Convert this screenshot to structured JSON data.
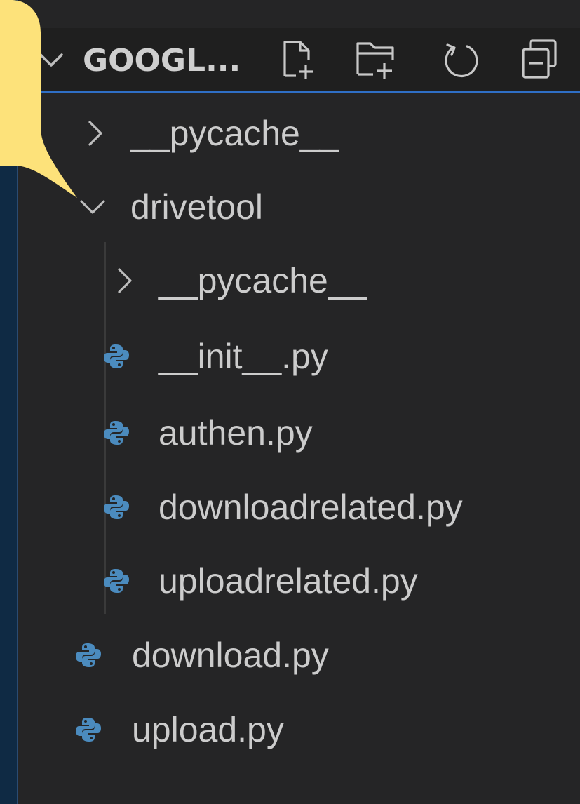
{
  "explorer": {
    "title": "GOOGL...",
    "actions": [
      {
        "name": "new-file-button",
        "icon": "new-file-icon"
      },
      {
        "name": "new-folder-button",
        "icon": "new-folder-icon"
      },
      {
        "name": "refresh-button",
        "icon": "refresh-icon"
      },
      {
        "name": "collapse-all-button",
        "icon": "collapse-all-icon"
      }
    ],
    "tree": [
      {
        "label": "__pycache__",
        "kind": "folder",
        "expanded": false,
        "depth": 0
      },
      {
        "label": "drivetool",
        "kind": "folder",
        "expanded": true,
        "depth": 0
      },
      {
        "label": "__pycache__",
        "kind": "folder",
        "expanded": false,
        "depth": 1
      },
      {
        "label": "__init__.py",
        "kind": "python-file",
        "depth": 1
      },
      {
        "label": "authen.py",
        "kind": "python-file",
        "depth": 1
      },
      {
        "label": "downloadrelated.py",
        "kind": "python-file",
        "depth": 1
      },
      {
        "label": "uploadrelated.py",
        "kind": "python-file",
        "depth": 1
      },
      {
        "label": "download.py",
        "kind": "python-file",
        "depth": 0
      },
      {
        "label": "upload.py",
        "kind": "python-file",
        "depth": 0
      }
    ]
  },
  "colors": {
    "sidebar_bg": "#252526",
    "header_bg": "#1f1f1f",
    "focus_border": "#2f6fc6",
    "text": "#cccccc",
    "python_icon": "#4b8bbe",
    "callout": "#fde27a",
    "outer_bg": "#0f2a44"
  }
}
